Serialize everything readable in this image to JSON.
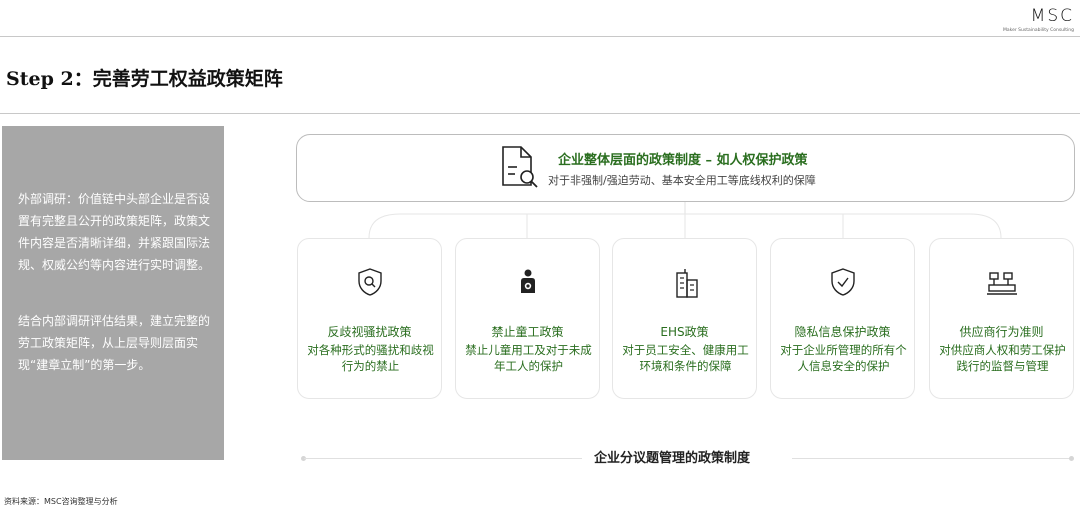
{
  "header": {
    "logo": "MSC",
    "logo_sub": "Maker Sustainability Consulting",
    "title": "Step 2：完善劳工权益政策矩阵"
  },
  "sidebar": {
    "para1": "外部调研：价值链中头部企业是否设置有完整且公开的政策矩阵，政策文件内容是否清晰详细，并紧跟国际法规、权威公约等内容进行实时调整。",
    "para2": "结合内部调研评估结果，建立完整的劳工政策矩阵，从上层导则层面实现“建章立制”的第一步。"
  },
  "top_policy": {
    "icon": "document-search-icon",
    "heading": "企业整体层面的政策制度 – 如人权保护政策",
    "description": "对于非强制/强迫劳动、基本安全用工等底线权利的保障"
  },
  "cards": [
    {
      "icon": "shield-search-icon",
      "title": "反歧视骚扰政策",
      "description": "对各种形式的骚扰和歧视行为的禁止"
    },
    {
      "icon": "child-icon",
      "title": "禁止童工政策",
      "description": "禁止儿童用工及对于未成年工人的保护"
    },
    {
      "icon": "building-icon",
      "title": "EHS政策",
      "description": "对于员工安全、健康用工环境和条件的保障"
    },
    {
      "icon": "shield-check-icon",
      "title": "隐私信息保护政策",
      "description": "对于企业所管理的所有个人信息安全的保护"
    },
    {
      "icon": "supplier-factory-icon",
      "title": "供应商行为准则",
      "description": "对供应商人权和劳工保护践行的监督与管理"
    }
  ],
  "bottom_label": "企业分议题管理的政策制度",
  "source": "资料来源：MSC咨询整理与分析",
  "colors": {
    "accent": "#2a6e1f",
    "sidebar_bg": "#a7a7a7",
    "border": "#bcbcbc"
  }
}
